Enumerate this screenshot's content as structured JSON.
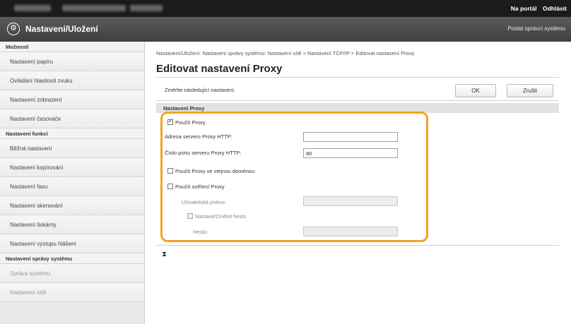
{
  "top_bar": {
    "portal_link": "Na portál",
    "logout_link": "Odhlásit"
  },
  "title_bar": {
    "logo_icon": "gear-icon",
    "title": "Nastavení/Uložení",
    "right_link": "Poslat správci systému"
  },
  "sidebar": {
    "sections": [
      {
        "header": "Možnosti",
        "items": [
          {
            "label": "Nastavení papíru",
            "dim": false
          },
          {
            "label": "Ovládání hlasitosti zvuku",
            "dim": false
          },
          {
            "label": "Nastavení zobrazení",
            "dim": false
          },
          {
            "label": "Nastavení časovače",
            "dim": false
          }
        ]
      },
      {
        "header": "Nastavení funkcí",
        "items": [
          {
            "label": "Běžná nastavení",
            "dim": false
          },
          {
            "label": "Nastavení kopírování",
            "dim": false
          },
          {
            "label": "Nastavení faxu",
            "dim": false
          },
          {
            "label": "Nastavení skenování",
            "dim": false
          },
          {
            "label": "Nastavení tiskárny",
            "dim": false
          },
          {
            "label": "Nastavení výstupu hlášení",
            "dim": false
          }
        ]
      },
      {
        "header": "Nastavení správy systému",
        "items": [
          {
            "label": "Správa systému",
            "dim": true
          },
          {
            "label": "Nastavení sítě",
            "dim": true
          }
        ]
      }
    ]
  },
  "main": {
    "breadcrumb": "Nastavení/Uložení: Nastavení správy systému: Nastavení sítě > Nastavení TCP/IP > Editovat nastavení Proxy",
    "page_title": "Editovat nastavení Proxy",
    "instruction": "Změňte následující nastavení.",
    "ok_label": "OK",
    "cancel_label": "Zrušit",
    "section_title": "Nastavení Proxy",
    "use_proxy_label": "Použít Proxy",
    "use_proxy_checked": true,
    "http_proxy_address_label": "Adresa serveru Proxy HTTP:",
    "http_proxy_address_value": "",
    "http_proxy_port_label": "Číslo portu serveru Proxy HTTP:",
    "http_proxy_port_value": "80",
    "same_domain_label": "Použít Proxy ve stejnou doménou",
    "same_domain_checked": false,
    "auth_label": "Použít ověření Proxy",
    "auth_checked": false,
    "username_label": "Uživatelské jméno:",
    "username_value": "",
    "set_change_password_label": "Nastavit/Změnit heslo",
    "set_change_password_checked": false,
    "password_label": "Heslo:",
    "password_value": "",
    "tree_icon": "expand-collapse-icon"
  },
  "colors": {
    "highlight": "#f4a323",
    "top_bar": "#1b1b1b",
    "title_bar": "#4a4a4a",
    "sidebar": "#e9e9e9"
  }
}
